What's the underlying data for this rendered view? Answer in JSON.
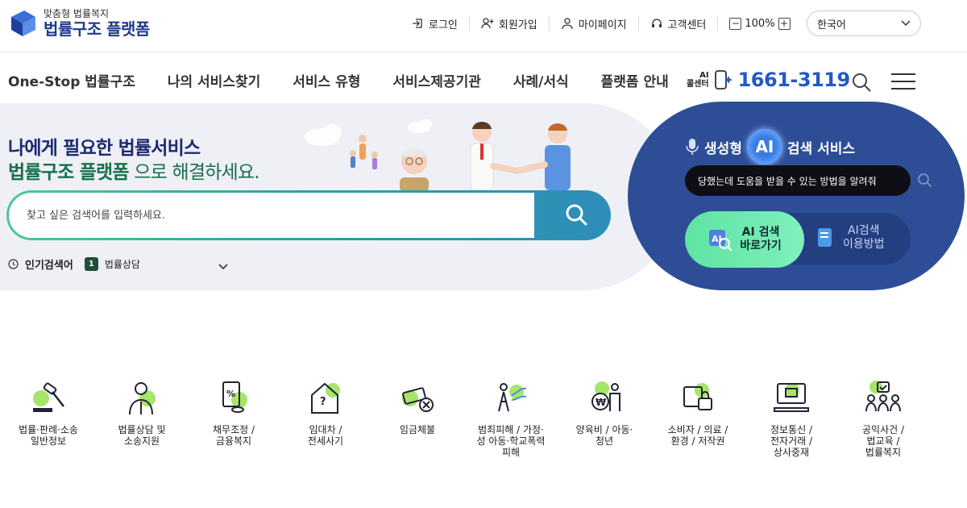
{
  "header": {
    "logo_sub": "맞춤형 법률복지",
    "logo_title": "법률구조 플랫폼",
    "util": {
      "login": "로그인",
      "signup": "회원가입",
      "mypage": "마이페이지",
      "support": "고객센터",
      "zoom_level": "100%",
      "zoom_minus": "−",
      "zoom_plus": "+"
    },
    "language": "한국어"
  },
  "nav": {
    "items": [
      {
        "label": "One-Stop 법률구조"
      },
      {
        "label": "나의 서비스찾기"
      },
      {
        "label": "서비스 유형"
      },
      {
        "label": "서비스제공기관"
      },
      {
        "label": "사례/서식"
      },
      {
        "label": "플랫폼 안내"
      }
    ],
    "callcenter_ai": "AI",
    "callcenter_label": "콜센터",
    "callcenter_number": "1661-3119"
  },
  "hero": {
    "title": "나에게 필요한 법률서비스",
    "subtitle_bold": "법률구조 플랫폼",
    "subtitle_rest": " 으로 해결하세요.",
    "search_placeholder": "찾고 싶은 검색어를 입력하세요.",
    "popular_label": "인기검색어",
    "popular_rank": "1",
    "popular_keyword": "법률상담"
  },
  "ai": {
    "title_pre": "생성형",
    "badge": "AI",
    "title_post": "검색 서비스",
    "query": "당했는데 도움을 받을 수 있는 방법을 알려줘",
    "go_line1": "AI 검색",
    "go_line2": "바로가기",
    "how_line1": "AI검색",
    "how_line2": "이용방법"
  },
  "categories": [
    {
      "lines": [
        "법률·판례·소송",
        "일반정보"
      ],
      "icon": "gavel-icon"
    },
    {
      "lines": [
        "법률상담 및",
        "소송지원"
      ],
      "icon": "lawyer-icon"
    },
    {
      "lines": [
        "채무조정 /",
        "금융복지"
      ],
      "icon": "debt-document-icon"
    },
    {
      "lines": [
        "임대차 /",
        "전세사기"
      ],
      "icon": "house-question-icon"
    },
    {
      "lines": [
        "임금체불"
      ],
      "icon": "unpaid-wage-icon"
    },
    {
      "lines": [
        "범죄피해 / 가정·",
        "성 아동·학교폭력",
        "피해"
      ],
      "icon": "crime-victim-icon"
    },
    {
      "lines": [
        "양육비 / 아동·",
        "청년"
      ],
      "icon": "child-support-icon"
    },
    {
      "lines": [
        "소비자 / 의료 /",
        "환경 / 저작권"
      ],
      "icon": "consumer-lock-icon"
    },
    {
      "lines": [
        "정보통신 /",
        "전자거래 /",
        "상사중재"
      ],
      "icon": "computer-icon"
    },
    {
      "lines": [
        "공익사건 /",
        "법교육 /",
        "법률복지"
      ],
      "icon": "public-interest-icon"
    }
  ]
}
